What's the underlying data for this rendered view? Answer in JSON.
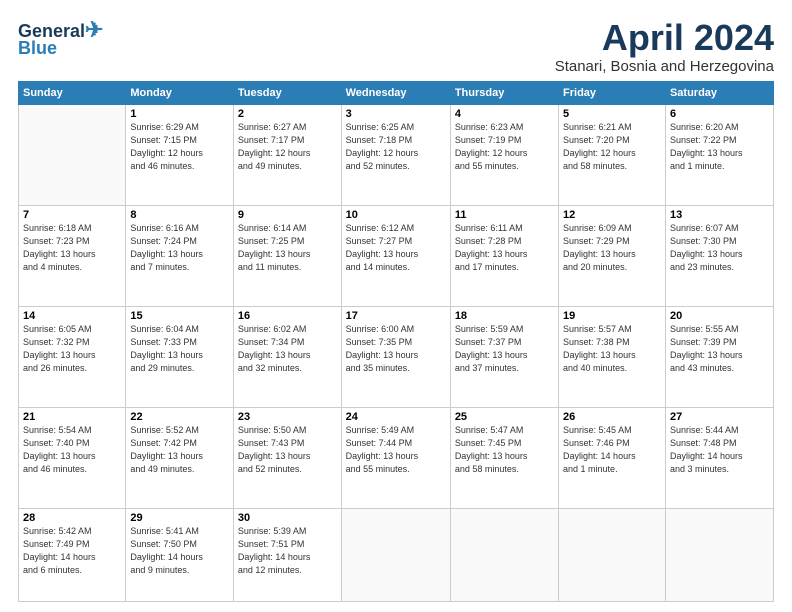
{
  "header": {
    "logo_line1": "General",
    "logo_line2": "Blue",
    "month_title": "April 2024",
    "subtitle": "Stanari, Bosnia and Herzegovina"
  },
  "weekdays": [
    "Sunday",
    "Monday",
    "Tuesday",
    "Wednesday",
    "Thursday",
    "Friday",
    "Saturday"
  ],
  "weeks": [
    [
      {
        "day": "",
        "info": ""
      },
      {
        "day": "1",
        "info": "Sunrise: 6:29 AM\nSunset: 7:15 PM\nDaylight: 12 hours\nand 46 minutes."
      },
      {
        "day": "2",
        "info": "Sunrise: 6:27 AM\nSunset: 7:17 PM\nDaylight: 12 hours\nand 49 minutes."
      },
      {
        "day": "3",
        "info": "Sunrise: 6:25 AM\nSunset: 7:18 PM\nDaylight: 12 hours\nand 52 minutes."
      },
      {
        "day": "4",
        "info": "Sunrise: 6:23 AM\nSunset: 7:19 PM\nDaylight: 12 hours\nand 55 minutes."
      },
      {
        "day": "5",
        "info": "Sunrise: 6:21 AM\nSunset: 7:20 PM\nDaylight: 12 hours\nand 58 minutes."
      },
      {
        "day": "6",
        "info": "Sunrise: 6:20 AM\nSunset: 7:22 PM\nDaylight: 13 hours\nand 1 minute."
      }
    ],
    [
      {
        "day": "7",
        "info": "Sunrise: 6:18 AM\nSunset: 7:23 PM\nDaylight: 13 hours\nand 4 minutes."
      },
      {
        "day": "8",
        "info": "Sunrise: 6:16 AM\nSunset: 7:24 PM\nDaylight: 13 hours\nand 7 minutes."
      },
      {
        "day": "9",
        "info": "Sunrise: 6:14 AM\nSunset: 7:25 PM\nDaylight: 13 hours\nand 11 minutes."
      },
      {
        "day": "10",
        "info": "Sunrise: 6:12 AM\nSunset: 7:27 PM\nDaylight: 13 hours\nand 14 minutes."
      },
      {
        "day": "11",
        "info": "Sunrise: 6:11 AM\nSunset: 7:28 PM\nDaylight: 13 hours\nand 17 minutes."
      },
      {
        "day": "12",
        "info": "Sunrise: 6:09 AM\nSunset: 7:29 PM\nDaylight: 13 hours\nand 20 minutes."
      },
      {
        "day": "13",
        "info": "Sunrise: 6:07 AM\nSunset: 7:30 PM\nDaylight: 13 hours\nand 23 minutes."
      }
    ],
    [
      {
        "day": "14",
        "info": "Sunrise: 6:05 AM\nSunset: 7:32 PM\nDaylight: 13 hours\nand 26 minutes."
      },
      {
        "day": "15",
        "info": "Sunrise: 6:04 AM\nSunset: 7:33 PM\nDaylight: 13 hours\nand 29 minutes."
      },
      {
        "day": "16",
        "info": "Sunrise: 6:02 AM\nSunset: 7:34 PM\nDaylight: 13 hours\nand 32 minutes."
      },
      {
        "day": "17",
        "info": "Sunrise: 6:00 AM\nSunset: 7:35 PM\nDaylight: 13 hours\nand 35 minutes."
      },
      {
        "day": "18",
        "info": "Sunrise: 5:59 AM\nSunset: 7:37 PM\nDaylight: 13 hours\nand 37 minutes."
      },
      {
        "day": "19",
        "info": "Sunrise: 5:57 AM\nSunset: 7:38 PM\nDaylight: 13 hours\nand 40 minutes."
      },
      {
        "day": "20",
        "info": "Sunrise: 5:55 AM\nSunset: 7:39 PM\nDaylight: 13 hours\nand 43 minutes."
      }
    ],
    [
      {
        "day": "21",
        "info": "Sunrise: 5:54 AM\nSunset: 7:40 PM\nDaylight: 13 hours\nand 46 minutes."
      },
      {
        "day": "22",
        "info": "Sunrise: 5:52 AM\nSunset: 7:42 PM\nDaylight: 13 hours\nand 49 minutes."
      },
      {
        "day": "23",
        "info": "Sunrise: 5:50 AM\nSunset: 7:43 PM\nDaylight: 13 hours\nand 52 minutes."
      },
      {
        "day": "24",
        "info": "Sunrise: 5:49 AM\nSunset: 7:44 PM\nDaylight: 13 hours\nand 55 minutes."
      },
      {
        "day": "25",
        "info": "Sunrise: 5:47 AM\nSunset: 7:45 PM\nDaylight: 13 hours\nand 58 minutes."
      },
      {
        "day": "26",
        "info": "Sunrise: 5:45 AM\nSunset: 7:46 PM\nDaylight: 14 hours\nand 1 minute."
      },
      {
        "day": "27",
        "info": "Sunrise: 5:44 AM\nSunset: 7:48 PM\nDaylight: 14 hours\nand 3 minutes."
      }
    ],
    [
      {
        "day": "28",
        "info": "Sunrise: 5:42 AM\nSunset: 7:49 PM\nDaylight: 14 hours\nand 6 minutes."
      },
      {
        "day": "29",
        "info": "Sunrise: 5:41 AM\nSunset: 7:50 PM\nDaylight: 14 hours\nand 9 minutes."
      },
      {
        "day": "30",
        "info": "Sunrise: 5:39 AM\nSunset: 7:51 PM\nDaylight: 14 hours\nand 12 minutes."
      },
      {
        "day": "",
        "info": ""
      },
      {
        "day": "",
        "info": ""
      },
      {
        "day": "",
        "info": ""
      },
      {
        "day": "",
        "info": ""
      }
    ]
  ]
}
